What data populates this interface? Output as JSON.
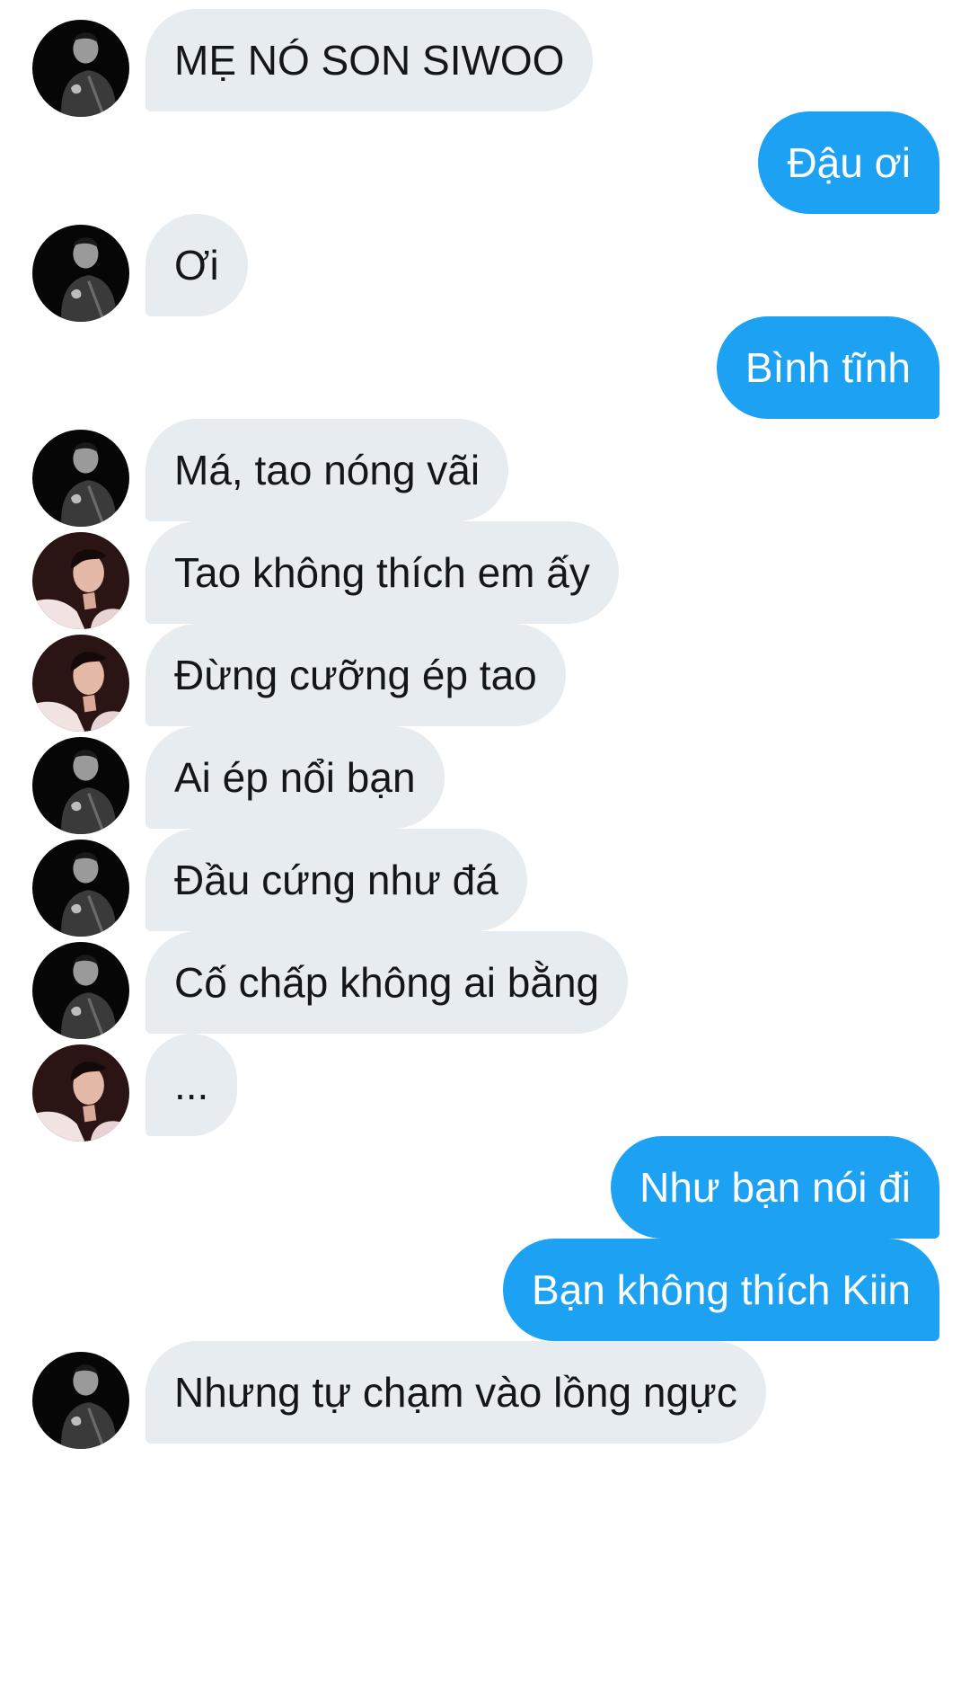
{
  "messages": [
    {
      "side": "in",
      "avatar": "avatar-dark",
      "text": "MẸ NÓ SON SIWOO"
    },
    {
      "side": "out",
      "text": "Đậu ơi"
    },
    {
      "side": "in",
      "avatar": "avatar-dark",
      "text": "Ơi"
    },
    {
      "side": "out",
      "text": "Bình tĩnh"
    },
    {
      "side": "in",
      "avatar": "avatar-dark",
      "text": "Má, tao nóng vãi"
    },
    {
      "side": "in",
      "avatar": "avatar-warm",
      "text": "Tao không thích em ấy"
    },
    {
      "side": "in",
      "avatar": "avatar-warm",
      "text": "Đừng cưỡng ép tao"
    },
    {
      "side": "in",
      "avatar": "avatar-dark",
      "text": "Ai ép nổi bạn"
    },
    {
      "side": "in",
      "avatar": "avatar-dark",
      "text": "Đầu cứng như đá"
    },
    {
      "side": "in",
      "avatar": "avatar-dark",
      "text": "Cố chấp không ai bằng"
    },
    {
      "side": "in",
      "avatar": "avatar-warm",
      "text": "..."
    },
    {
      "side": "out",
      "text": "Như bạn nói đi"
    },
    {
      "side": "out",
      "text": "Bạn không thích Kiin"
    },
    {
      "side": "in",
      "avatar": "avatar-dark",
      "text": "Nhưng tự chạm vào lồng ngực"
    }
  ],
  "colors": {
    "incoming_bubble": "#e6ecf0",
    "incoming_text": "#14171a",
    "outgoing_bubble": "#1da1f2",
    "outgoing_text": "#ffffff"
  }
}
